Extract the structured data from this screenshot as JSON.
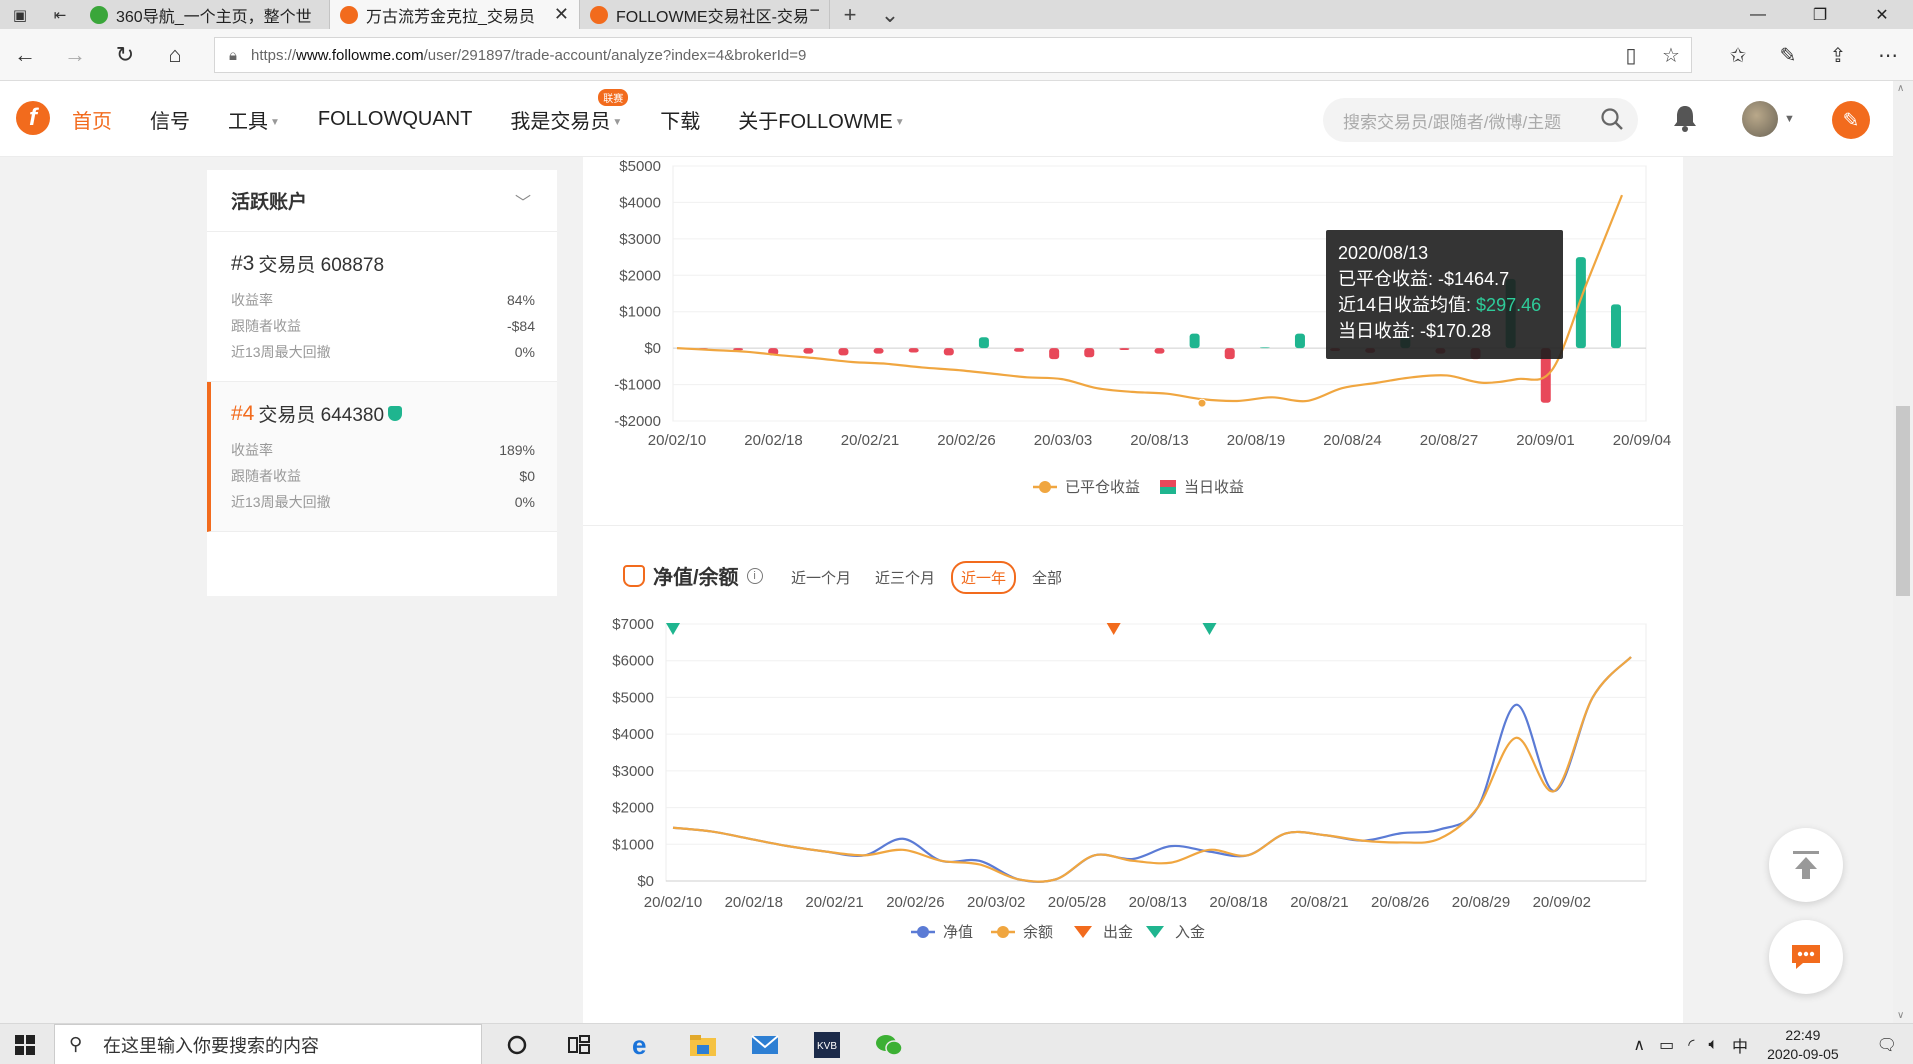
{
  "browser": {
    "tabs": [
      {
        "title": "360导航_一个主页，整个世",
        "active": false,
        "color": "#3aa63a"
      },
      {
        "title": "万古流芳金克拉_交易员",
        "active": true,
        "color": "#f26b1d"
      },
      {
        "title": "FOLLOWME交易社区-交易乛",
        "active": false,
        "color": "#f26b1d"
      }
    ],
    "url_prefix": "https://",
    "url_host": "www.followme.com",
    "url_path": "/user/291897/trade-account/analyze?index=4&brokerId=9"
  },
  "header": {
    "menu": [
      {
        "label": "首页",
        "active": true,
        "caret": false
      },
      {
        "label": "信号",
        "active": false,
        "caret": false
      },
      {
        "label": "工具",
        "active": false,
        "caret": true
      },
      {
        "label": "FOLLOWQUANT",
        "active": false,
        "caret": false
      },
      {
        "label": "我是交易员",
        "active": false,
        "caret": true,
        "badge": "联赛"
      },
      {
        "label": "下载",
        "active": false,
        "caret": false
      },
      {
        "label": "关于FOLLOWME",
        "active": false,
        "caret": true
      }
    ],
    "search_placeholder": "搜索交易员/跟随者/微博/主题",
    "accent": "#f26b1d"
  },
  "sidebar": {
    "title": "活跃账户",
    "accounts": [
      {
        "rank": "#3",
        "name": "交易员 608878",
        "verified": false,
        "active": false,
        "rows": [
          {
            "label": "收益率",
            "value": "84%"
          },
          {
            "label": "跟随者收益",
            "value": "-$84"
          },
          {
            "label": "近13周最大回撤",
            "value": "0%"
          }
        ]
      },
      {
        "rank": "#4",
        "name": "交易员 644380",
        "verified": true,
        "active": true,
        "rows": [
          {
            "label": "收益率",
            "value": "189%"
          },
          {
            "label": "跟随者收益",
            "value": "$0"
          },
          {
            "label": "近13周最大回撤",
            "value": "0%"
          }
        ]
      }
    ]
  },
  "tooltip": {
    "date": "2020/08/13",
    "closed_label": "已平仓收益:",
    "closed_value": "-$1464.7",
    "avg_label": "近14日收益均值:",
    "avg_value": "$297.46",
    "daily_label": "当日收益:",
    "daily_value": "-$170.28"
  },
  "section2": {
    "title": "净值/余额",
    "periods": [
      {
        "label": "近一个月",
        "active": false
      },
      {
        "label": "近三个月",
        "active": false
      },
      {
        "label": "近一年",
        "active": true
      },
      {
        "label": "全部",
        "active": false
      }
    ]
  },
  "chart_data": [
    {
      "type": "bar",
      "yticks": [
        "$5000",
        "$4000",
        "$3000",
        "$2000",
        "$1000",
        "$0",
        "-$1000",
        "-$2000"
      ],
      "ylim": [
        -2000,
        5000
      ],
      "xticks": [
        "20/02/10",
        "20/02/18",
        "20/02/21",
        "20/02/26",
        "20/03/03",
        "20/08/13",
        "20/08/19",
        "20/08/24",
        "20/08/27",
        "20/09/01",
        "20/09/04"
      ],
      "legend": [
        "已平仓收益",
        "当日收益"
      ],
      "legend_position": "bottom",
      "colors": {
        "line": "#f0a640",
        "positive": "#1fb58f",
        "negative": "#e8485a"
      },
      "daily_bars": [
        -50,
        -60,
        -200,
        -150,
        -200,
        -150,
        -120,
        -200,
        300,
        -100,
        -300,
        -250,
        -50,
        -150,
        400,
        -300,
        20,
        400,
        -80,
        -130,
        300,
        -150,
        -300,
        1900,
        -1500,
        2500,
        1200
      ],
      "closed_line": [
        0,
        -50,
        -100,
        -200,
        -280,
        -380,
        -430,
        -530,
        -600,
        -700,
        -800,
        -850,
        -1100,
        -1200,
        -1250,
        -1400,
        -1450,
        -1350,
        -1450,
        -1100,
        -950,
        -800,
        -750,
        -950,
        -850,
        -600,
        1800,
        4200
      ]
    },
    {
      "type": "line",
      "yticks": [
        "$7000",
        "$6000",
        "$5000",
        "$4000",
        "$3000",
        "$2000",
        "$1000",
        "$0"
      ],
      "ylim": [
        0,
        7000
      ],
      "xticks": [
        "20/02/10",
        "20/02/18",
        "20/02/21",
        "20/02/26",
        "20/03/02",
        "20/05/28",
        "20/08/13",
        "20/08/18",
        "20/08/21",
        "20/08/26",
        "20/08/29",
        "20/09/02"
      ],
      "legend": [
        "净值",
        "余额",
        "出金",
        "入金"
      ],
      "legend_position": "bottom",
      "colors": {
        "equity": "#5b7bd5",
        "balance": "#f0a640",
        "withdraw": "#f26b1d",
        "deposit": "#1fb58f"
      },
      "equity": [
        1450,
        1350,
        1150,
        950,
        800,
        700,
        1150,
        550,
        550,
        50,
        50,
        700,
        600,
        950,
        800,
        700,
        1300,
        1250,
        1100,
        1300,
        1400,
        2000,
        4800,
        2450,
        5000,
        6100
      ],
      "balance": [
        1450,
        1350,
        1150,
        950,
        800,
        700,
        850,
        550,
        450,
        50,
        50,
        700,
        550,
        500,
        850,
        700,
        1300,
        1250,
        1100,
        1050,
        1150,
        2000,
        3900,
        2450,
        5000,
        6100
      ],
      "markers": [
        {
          "type": "入金",
          "at": 0
        },
        {
          "type": "出金",
          "at": 0.46
        },
        {
          "type": "入金",
          "at": 0.56
        }
      ]
    }
  ],
  "taskbar": {
    "search_placeholder": "在这里输入你要搜索的内容",
    "ime": "中",
    "time": "22:49",
    "date": "2020-09-05"
  }
}
